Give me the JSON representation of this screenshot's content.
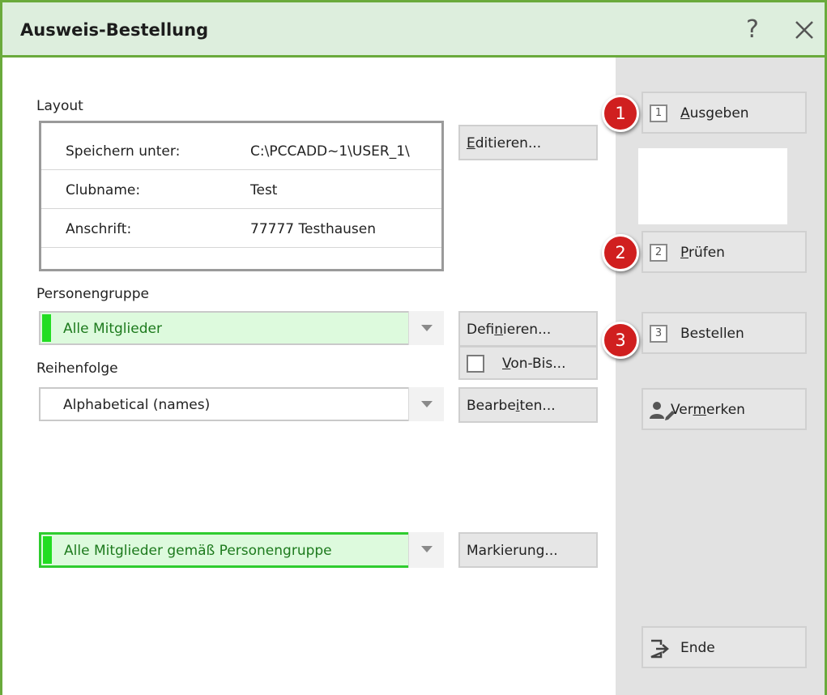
{
  "window": {
    "title": "Ausweis-Bestellung",
    "help_label": "?"
  },
  "layout_section": {
    "label": "Layout",
    "rows": [
      {
        "key": "Speichern unter:",
        "value": "C:\\PCCADD~1\\USER_1\\"
      },
      {
        "key": "Clubname:",
        "value": "Test"
      },
      {
        "key": "Anschrift:",
        "value": "77777 Testhausen"
      }
    ],
    "edit_button": {
      "pre": "",
      "accel": "E",
      "post": "ditieren..."
    }
  },
  "personengruppe": {
    "label": "Personengruppe",
    "selected": "Alle Mitglieder",
    "define_button": {
      "pre": "Defi",
      "accel": "n",
      "post": "ieren..."
    },
    "von_bis_button": {
      "pre": "",
      "accel": "V",
      "post": "on-Bis..."
    }
  },
  "reihenfolge": {
    "label": "Reihenfolge",
    "selected": "Alphabetical (names)",
    "edit_button": {
      "pre": "Bearbe",
      "accel": "i",
      "post": "ten..."
    }
  },
  "markierung": {
    "selected": "Alle Mitglieder gemäß Personengruppe",
    "button_label": "Markierung..."
  },
  "side_panel": {
    "ausgeben": {
      "num": "1",
      "pre": "",
      "accel": "A",
      "post": "usgeben",
      "badge": "1"
    },
    "pruefen": {
      "num": "2",
      "pre": "",
      "accel": "P",
      "post": "rüfen",
      "badge": "2"
    },
    "bestellen": {
      "num": "3",
      "pre": "Bestellen",
      "accel": "",
      "post": "",
      "badge": "3"
    },
    "vermerken": {
      "pre": "Ver",
      "accel": "m",
      "post": "erken"
    },
    "ende": {
      "label": "Ende"
    }
  },
  "colors": {
    "accent_green": "#6aaa3c",
    "title_bg": "#ddeedd",
    "badge_red": "#d01f1f",
    "selected_green": "#22dd22"
  },
  "icons": [
    "close-icon",
    "help-icon",
    "dropdown-arrow-icon",
    "person-edit-icon",
    "exit-icon"
  ]
}
